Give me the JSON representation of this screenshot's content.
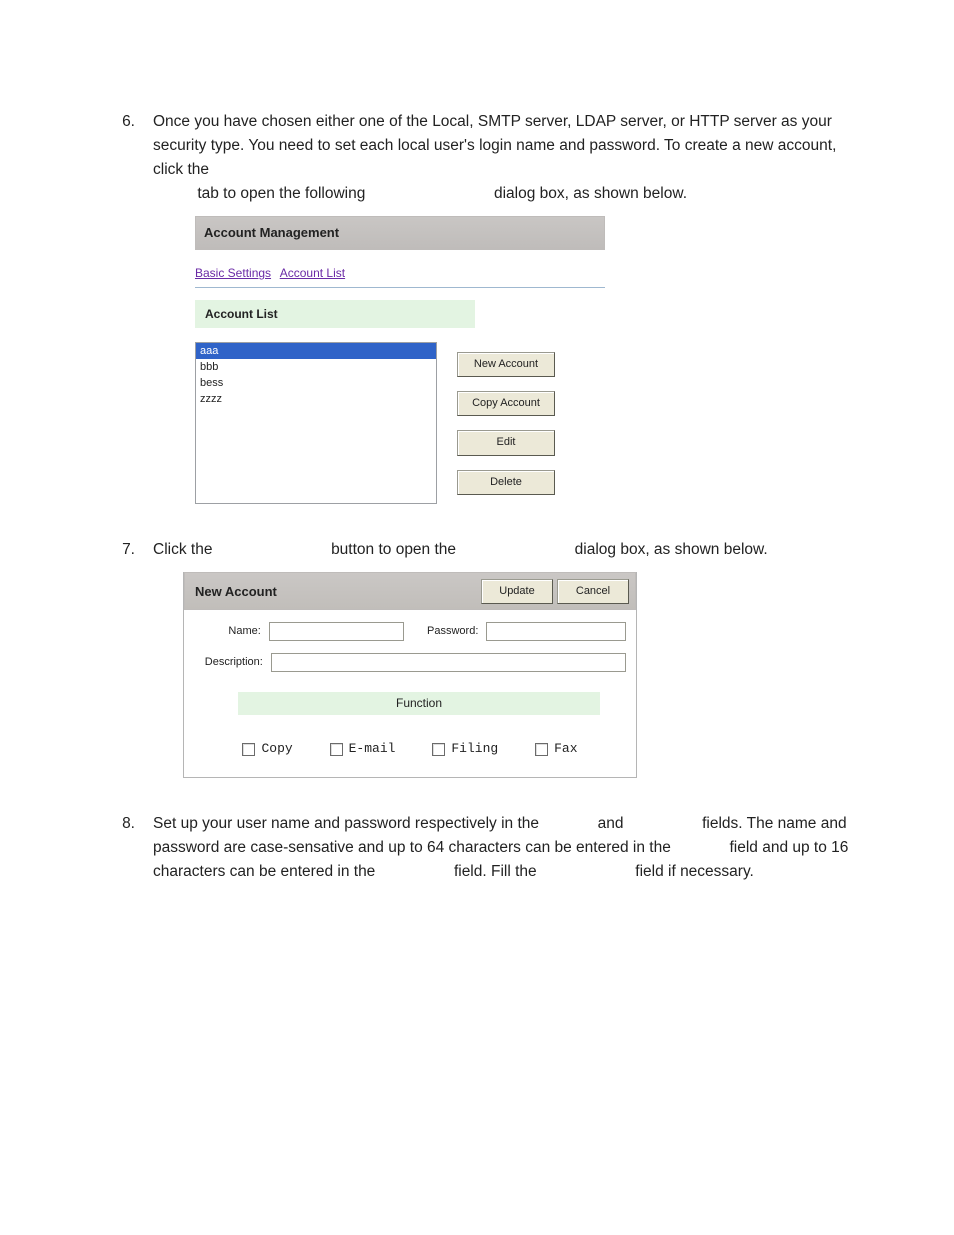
{
  "steps": {
    "s6": {
      "num": "6.",
      "text_a": "Once you have chosen either one of the Local, SMTP server, LDAP server, or HTTP server as your security type.   You need to set each local user's login name and password.   To create a new account, click the ",
      "text_b": "tab to open the following ",
      "text_c": "dialog box, as shown below."
    },
    "s7": {
      "num": "7.",
      "text_a": "Click the ",
      "text_b": "button to open the ",
      "text_c": "dialog box, as shown below."
    },
    "s8": {
      "num": "8.",
      "text_a": "Set up your user name and password respectively in the ",
      "text_b": "and ",
      "text_c": "fields.   The name and password are case-sensative and up to 64 characters can be entered in the ",
      "text_d": "field and up to 16 characters can be entered in the ",
      "text_e": "field.   Fill the ",
      "text_f": "field if necessary."
    }
  },
  "acct_mgmt": {
    "title": "Account Management",
    "tab_basic": "Basic Settings",
    "tab_list": "Account List",
    "section": "Account List",
    "items": [
      "aaa",
      "bbb",
      "bess",
      "zzzz"
    ],
    "btn_new": "New Account",
    "btn_copy": "Copy Account",
    "btn_edit": "Edit",
    "btn_delete": "Delete"
  },
  "new_acct": {
    "title": "New Account",
    "btn_update": "Update",
    "btn_cancel": "Cancel",
    "lbl_name": "Name:",
    "lbl_password": "Password:",
    "lbl_description": "Description:",
    "func_header": "Function",
    "fn_copy": "Copy",
    "fn_email": "E-mail",
    "fn_filing": "Filing",
    "fn_fax": "Fax"
  }
}
